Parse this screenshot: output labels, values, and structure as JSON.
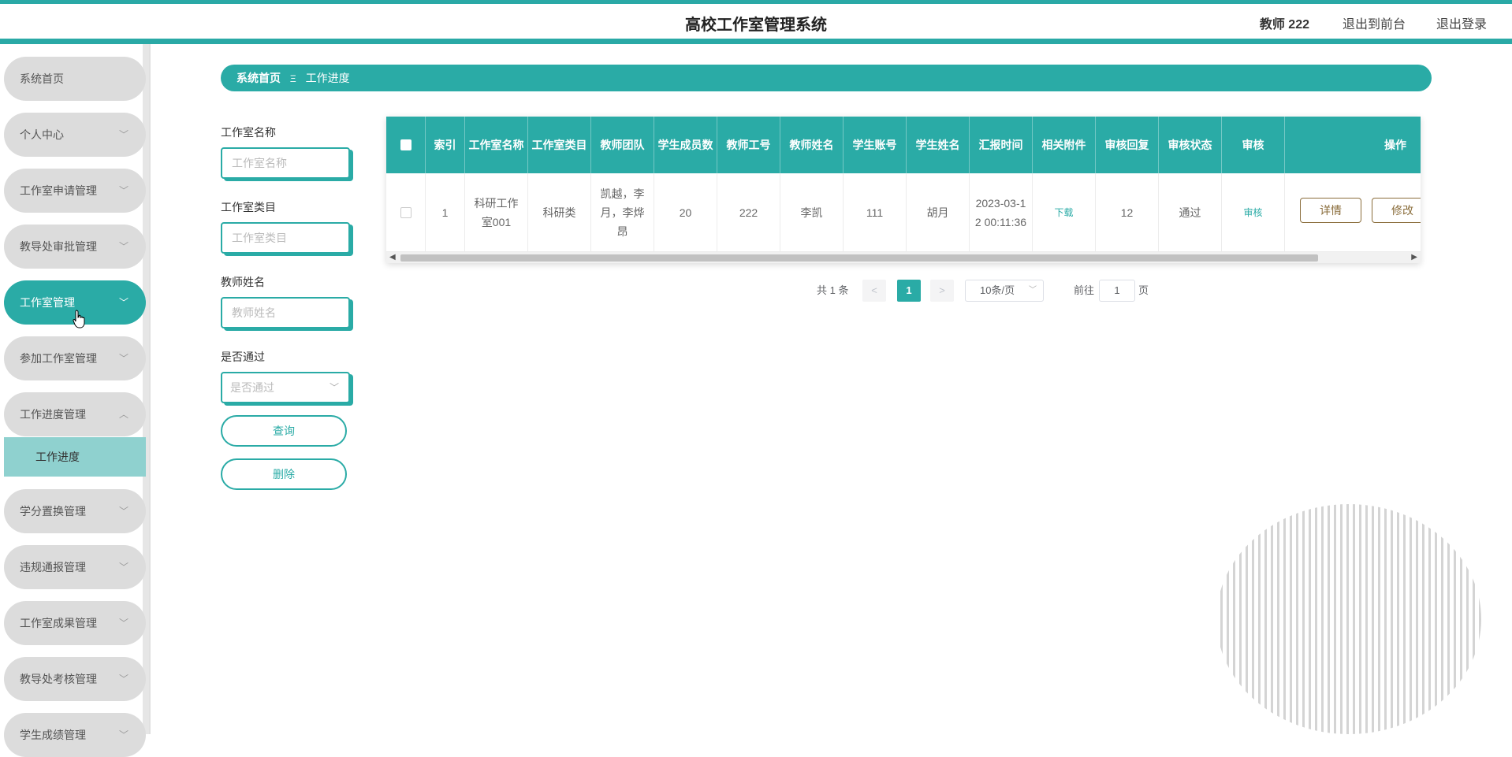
{
  "header": {
    "title": "高校工作室管理系统",
    "user": "教师 222",
    "front_link": "退出到前台",
    "logout_link": "退出登录"
  },
  "sidebar": {
    "items": [
      {
        "label": "系统首页"
      },
      {
        "label": "个人中心"
      },
      {
        "label": "工作室申请管理"
      },
      {
        "label": "教导处审批管理"
      },
      {
        "label": "工作室管理"
      },
      {
        "label": "参加工作室管理"
      },
      {
        "label": "工作进度管理"
      },
      {
        "label": "学分置换管理"
      },
      {
        "label": "违规通报管理"
      },
      {
        "label": "工作室成果管理"
      },
      {
        "label": "教导处考核管理"
      },
      {
        "label": "学生成绩管理"
      }
    ],
    "sub_item": "工作进度"
  },
  "breadcrumb": {
    "home": "系统首页",
    "separator": "Ξ",
    "current": "工作进度"
  },
  "search": {
    "name_label": "工作室名称",
    "name_placeholder": "工作室名称",
    "category_label": "工作室类目",
    "category_placeholder": "工作室类目",
    "teacher_label": "教师姓名",
    "teacher_placeholder": "教师姓名",
    "pass_label": "是否通过",
    "pass_placeholder": "是否通过",
    "query_button": "查询",
    "delete_button": "删除"
  },
  "table": {
    "headers": [
      "索引",
      "工作室名称",
      "工作室类目",
      "教师团队",
      "学生成员数",
      "教师工号",
      "教师姓名",
      "学生账号",
      "学生姓名",
      "汇报时间",
      "相关附件",
      "审核回复",
      "审核状态",
      "审核",
      "操作"
    ],
    "rows": [
      {
        "index": "1",
        "studio_name": "科研工作室001",
        "category": "科研类",
        "team": "凯越，李月，李烨昂",
        "members": "20",
        "teacher_id": "222",
        "teacher_name": "李凯",
        "student_account": "111",
        "student_name": "胡月",
        "report_time": "2023-03-12 00:11:36",
        "attachment": "下载",
        "review_reply": "12",
        "review_status": "通过",
        "review": "审核",
        "detail_button": "详情",
        "edit_button": "修改"
      }
    ]
  },
  "pagination": {
    "total": "共 1 条",
    "prev": "<",
    "current": "1",
    "next": ">",
    "page_size": "10条/页",
    "goto_prefix": "前往",
    "goto_value": "1",
    "goto_suffix": "页"
  }
}
